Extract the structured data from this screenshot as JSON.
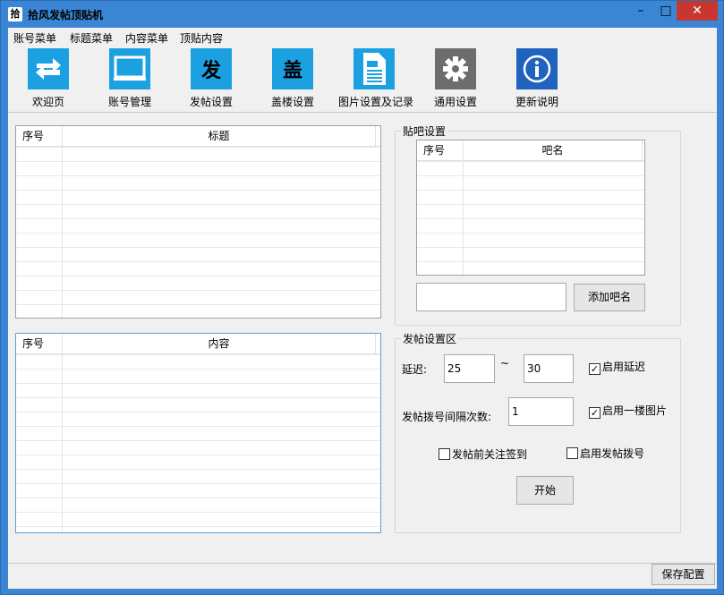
{
  "window": {
    "title": "拾风发帖顶贴机",
    "app_icon": "拾",
    "minimize": "–",
    "maximize": "□",
    "close": "✕"
  },
  "menu": [
    "账号菜单",
    "标题菜单",
    "内容菜单",
    "顶贴内容"
  ],
  "toolbar": [
    {
      "label": "欢迎页",
      "icon": "swap-arrows-icon"
    },
    {
      "label": "账号管理",
      "icon": "monitor-icon"
    },
    {
      "label": "发帖设置",
      "icon": "text-icon",
      "glyph": "发"
    },
    {
      "label": "盖楼设置",
      "icon": "text-icon",
      "glyph": "盖"
    },
    {
      "label": "图片设置及记录",
      "icon": "document-icon"
    },
    {
      "label": "通用设置",
      "icon": "gear-icon"
    },
    {
      "label": "更新说明",
      "icon": "info-icon"
    }
  ],
  "title_grid": {
    "col1": "序号",
    "col2": "标题"
  },
  "content_grid": {
    "col1": "序号",
    "col2": "内容"
  },
  "forum_settings": {
    "title": "贴吧设置",
    "grid": {
      "col1": "序号",
      "col2": "吧名"
    },
    "name_input": "",
    "add_button": "添加吧名"
  },
  "post_settings": {
    "title": "发帖设置区",
    "delay_label": "延迟:",
    "delay_min": "25",
    "tilde": "~",
    "delay_max": "30",
    "enable_delay": "启用延迟",
    "interval_label": "发帖拨号间隔次数:",
    "interval_value": "1",
    "enable_first_image": "启用一楼图片",
    "follow_sign": "发帖前关注签到",
    "enable_dial": "启用发帖拨号",
    "start_button": "开始"
  },
  "footer": {
    "save_button": "保存配置"
  },
  "colors": {
    "title_bar": "#3b86d4",
    "tool_icon_bg": "#1ba1e2",
    "close_button": "#c7372f"
  }
}
